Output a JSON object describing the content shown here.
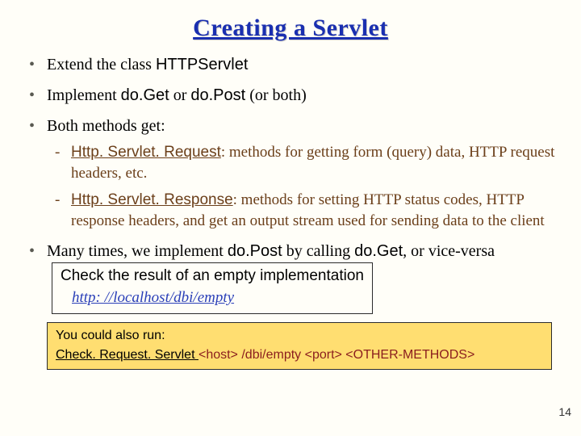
{
  "title": "Creating a Servlet",
  "bullets": {
    "b1": {
      "pre": "Extend the class ",
      "code": "HTTPServlet"
    },
    "b2": {
      "pre": "Implement ",
      "c1": "do.Get",
      "mid": " or ",
      "c2": "do.Post",
      "post": " (or both)"
    },
    "b3": {
      "text": "Both methods get:"
    },
    "sub1": {
      "code": "Http. Servlet. Request",
      "rest": ": methods for getting form (query) data, HTTP request headers, etc."
    },
    "sub2": {
      "code": "Http. Servlet. Response",
      "rest": ": methods for setting HTTP status codes, HTTP response headers, and get an output stream used for sending data to the client"
    },
    "b4": {
      "pre": "Many times, we implement ",
      "c1": "do.Post",
      "mid": " by calling ",
      "c2": "do.Get",
      "post": ", or vice-versa"
    }
  },
  "note": {
    "text": "Check the result of an empty implementation",
    "url": "http: //localhost/dbi/empty"
  },
  "footer": {
    "line1": "You could also run:",
    "link": "Check. Request. Servlet ",
    "rest": "<host> /dbi/empty <port> <OTHER-METHODS>"
  },
  "pagenum": "14"
}
